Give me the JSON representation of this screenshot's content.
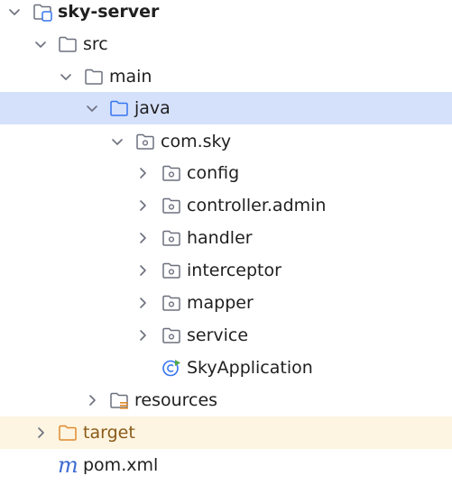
{
  "project_tree": {
    "root": {
      "label": "sky-server",
      "icon": "module-folder-icon"
    },
    "src": {
      "label": "src",
      "icon": "folder-icon"
    },
    "main": {
      "label": "main",
      "icon": "folder-icon"
    },
    "java": {
      "label": "java",
      "icon": "source-root-folder-icon"
    },
    "com_sky": {
      "label": "com.sky",
      "icon": "package-icon"
    },
    "packages": [
      {
        "label": "config",
        "icon": "package-icon"
      },
      {
        "label": "controller.admin",
        "icon": "package-icon"
      },
      {
        "label": "handler",
        "icon": "package-icon"
      },
      {
        "label": "interceptor",
        "icon": "package-icon"
      },
      {
        "label": "mapper",
        "icon": "package-icon"
      },
      {
        "label": "service",
        "icon": "package-icon"
      }
    ],
    "sky_application": {
      "label": "SkyApplication",
      "icon": "spring-boot-class-icon"
    },
    "resources": {
      "label": "resources",
      "icon": "resources-folder-icon"
    },
    "target": {
      "label": "target",
      "icon": "excluded-folder-icon"
    },
    "pom": {
      "label": "pom.xml",
      "icon": "maven-icon",
      "glyph": "m"
    }
  },
  "colors": {
    "selection": "#d5e1fb",
    "excluded_background": "#fdf5e1",
    "folder_stroke": "#6c707e",
    "source_folder_stroke": "#3574f0",
    "excluded_folder_stroke": "#e08a2c",
    "maven": "#3d6bd1"
  }
}
